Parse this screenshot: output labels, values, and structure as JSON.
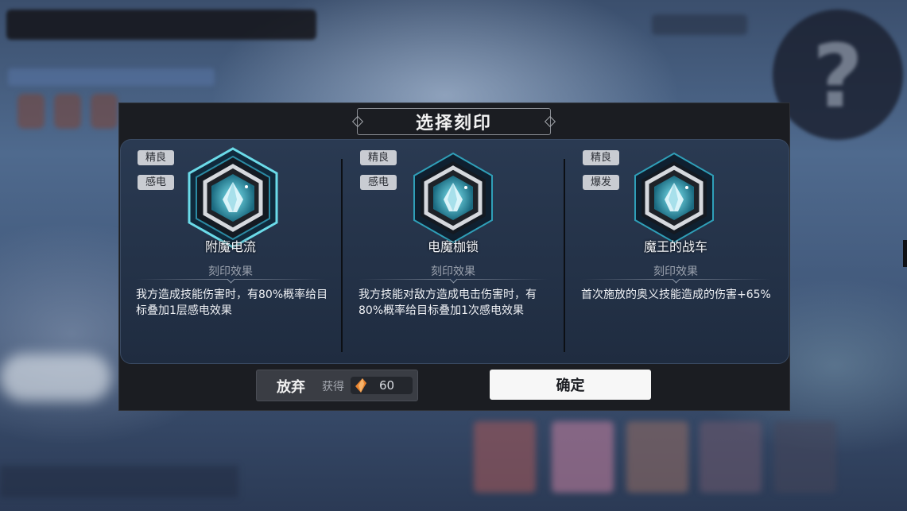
{
  "dialog": {
    "title": "选择刻印"
  },
  "cards": [
    {
      "tags": [
        "精良",
        "感电"
      ],
      "name": "附魔电流",
      "effect_label": "刻印效果",
      "description": "我方造成技能伤害时，有80%概率给目标叠加1层感电效果",
      "emblem_icon": "crystal-hexagon-emblem",
      "selected": true
    },
    {
      "tags": [
        "精良",
        "感电"
      ],
      "name": "电魔枷锁",
      "effect_label": "刻印效果",
      "description": "我方技能对敌方造成电击伤害时，有80%概率给目标叠加1次感电效果",
      "emblem_icon": "crystal-hexagon-emblem",
      "selected": false
    },
    {
      "tags": [
        "精良",
        "爆发"
      ],
      "name": "魔王的战车",
      "effect_label": "刻印效果",
      "description": "首次施放的奥义技能造成的伤害+65%",
      "emblem_icon": "crystal-hexagon-emblem",
      "selected": false
    }
  ],
  "actions": {
    "abandon_label": "放弃",
    "gain_label": "获得",
    "reward_amount": "60",
    "reward_icon": "orange-crystal-icon",
    "confirm_label": "确定"
  },
  "colors": {
    "accent_cyan": "#5fd6e6",
    "dialog_bg": "#1b1d22",
    "panel_bg": "#24344c",
    "confirm_bg": "#f7f7f7"
  }
}
